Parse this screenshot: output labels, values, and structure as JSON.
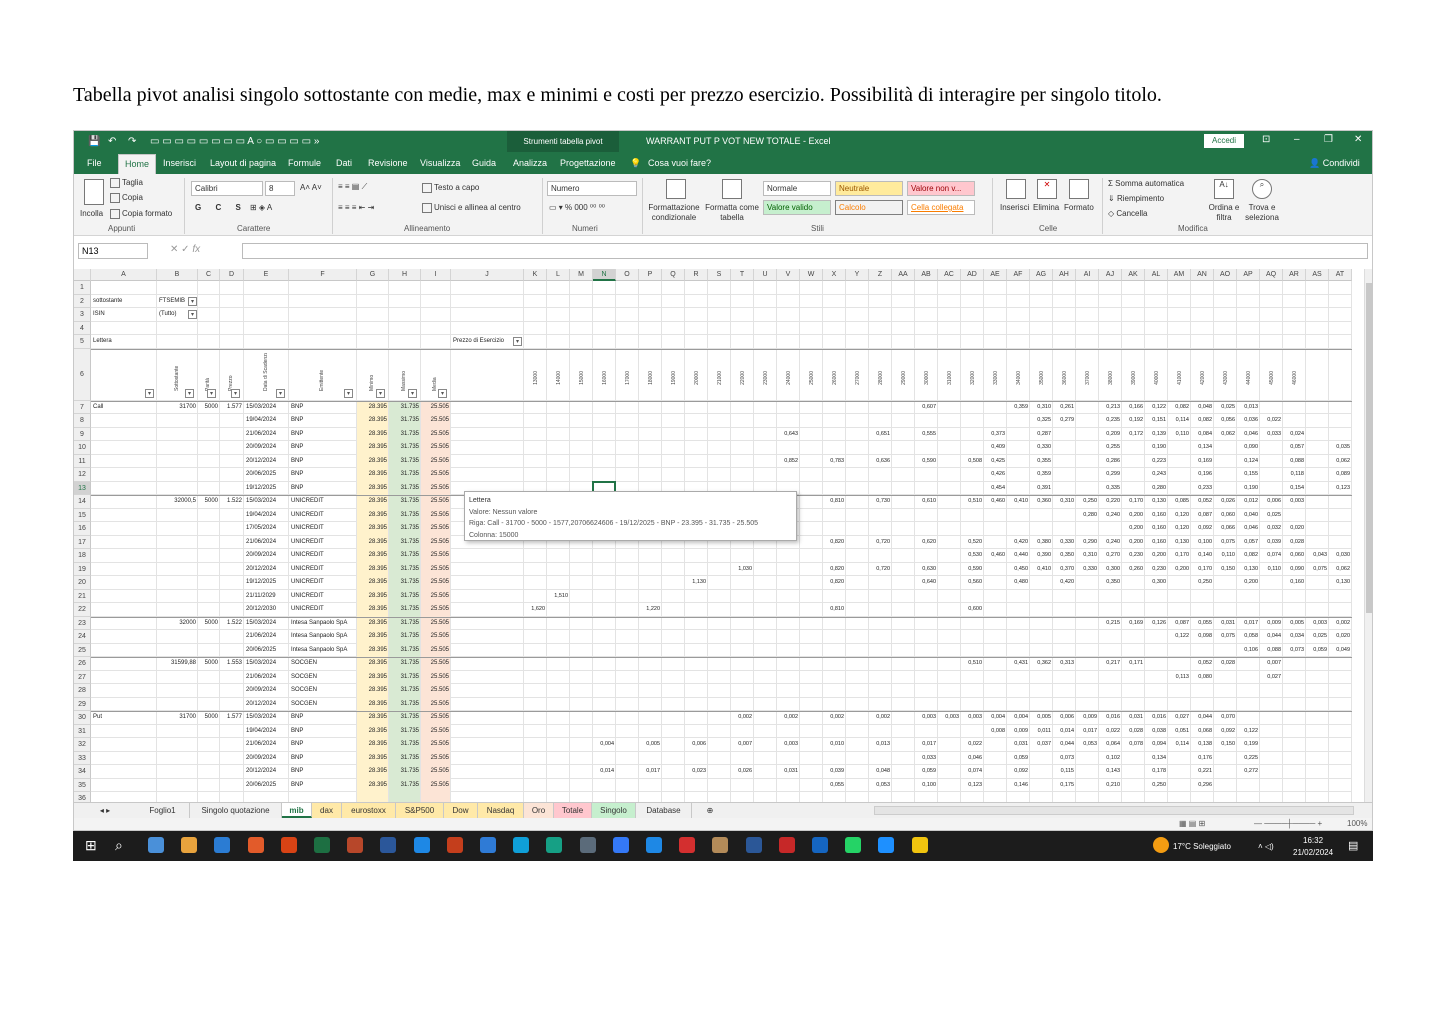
{
  "caption": "Tabella pivot analisi singolo sottostante con medie, max e minimi e costi per prezzo esercizio. Possibilità di interagire per singolo titolo.",
  "excel": {
    "context_tab": "Strumenti tabella pivot",
    "window_title": "WARRANT PUT P VOT NEW TOTALE - Excel",
    "signin": "Accedi",
    "menu": [
      "File",
      "Home",
      "Inserisci",
      "Layout di pagina",
      "Formule",
      "Dati",
      "Revisione",
      "Visualizza",
      "Guida",
      "Analizza",
      "Progettazione",
      "Cosa vuoi fare?"
    ],
    "share": "Condividi",
    "ribbon": {
      "paste": "Incolla",
      "cut": "Taglia",
      "copy": "Copia",
      "format_painter": "Copia formato",
      "font_name": "Calibri",
      "font_size": "8",
      "wrap_text": "Testo a capo",
      "merge": "Unisci e allinea al centro",
      "number_format": "Numero",
      "cond_format": "Formattazione condizionale",
      "format_table": "Formatta come tabella",
      "styles": [
        "Normale",
        "Neutrale",
        "Valore non v...",
        "Valore valido",
        "Calcolo",
        "Cella collegata"
      ],
      "insert": "Inserisci",
      "delete": "Elimina",
      "format": "Formato",
      "autosum": "Somma automatica",
      "fill": "Riempimento",
      "clear": "Cancella",
      "sort_filter": "Ordina e filtra",
      "find_select": "Trova e seleziona",
      "groups": [
        "Appunti",
        "Carattere",
        "Allineamento",
        "Numeri",
        "Stili",
        "Celle",
        "Modifica"
      ]
    },
    "name_box": "N13",
    "columns": [
      "A",
      "B",
      "C",
      "D",
      "E",
      "F",
      "G",
      "H",
      "I",
      "J",
      "K",
      "L",
      "M",
      "N",
      "O",
      "P",
      "Q",
      "R",
      "S",
      "T",
      "U",
      "V",
      "W",
      "X",
      "Y",
      "Z",
      "AA",
      "AB",
      "AC",
      "AD",
      "AE",
      "AF",
      "AG",
      "AH",
      "AI",
      "AJ",
      "AK",
      "AL",
      "AM",
      "AN",
      "AO",
      "AP",
      "AQ",
      "AR",
      "AS",
      "AT"
    ],
    "filters": {
      "row2_label": "sottostante",
      "row2_value": "FTSEMIB",
      "row3_label": "ISIN",
      "row3_value": "(Tutto)"
    },
    "row5": {
      "a": "Lettera",
      "j": "Prezzo di Esercizio"
    },
    "strikes": [
      "13000",
      "14000",
      "15000",
      "16000",
      "17000",
      "18000",
      "19000",
      "20000",
      "21000",
      "22000",
      "23000",
      "24000",
      "25000",
      "26000",
      "27000",
      "28000",
      "29000",
      "30000",
      "31000",
      "32000",
      "33000",
      "34000",
      "35000",
      "36000",
      "37000",
      "38000",
      "39000",
      "40000",
      "41000",
      "42000",
      "43000",
      "44000",
      "45000",
      "46000"
    ],
    "header_labels": {
      "b": "Sottostante",
      "c": "Parità",
      "d": "Prezzo",
      "e": "Data di Scadenza",
      "f": "Emittente",
      "g": "Minimo",
      "h": "Massimo",
      "i": "Media"
    },
    "rows": [
      {
        "n": 7,
        "a": "Call",
        "b": "31700",
        "c": "5000",
        "d": "1.577",
        "e": "15/03/2024",
        "f": "BNP",
        "g": "28.395",
        "h": "31.735",
        "i": "25.505",
        "v": {
          "AB": "0,607",
          "AF": "0,359",
          "AG": "0,310",
          "AH": "0,261",
          "AJ": "0,213",
          "AK": "0,166",
          "AL": "0,122",
          "AM": "0,082",
          "AN": "0,048",
          "AO": "0,025",
          "AP": "0,013"
        }
      },
      {
        "n": 8,
        "e": "19/04/2024",
        "f": "BNP",
        "g": "28.395",
        "h": "31.735",
        "i": "25.505",
        "v": {
          "AG": "0,325",
          "AH": "0,279",
          "AJ": "0,235",
          "AK": "0,192",
          "AL": "0,151",
          "AM": "0,114",
          "AN": "0,082",
          "AO": "0,056",
          "AP": "0,036",
          "AQ": "0,022"
        }
      },
      {
        "n": 9,
        "e": "21/06/2024",
        "f": "BNP",
        "g": "28.395",
        "h": "31.735",
        "i": "25.505",
        "v": {
          "V": "0,643",
          "Z": "0,651",
          "AB": "0,555",
          "AE": "0,373",
          "AG": "0,287",
          "AJ": "0,209",
          "AK": "0,172",
          "AL": "0,139",
          "AM": "0,110",
          "AN": "0,084",
          "AO": "0,062",
          "AP": "0,046",
          "AQ": "0,033",
          "AR": "0,024"
        }
      },
      {
        "n": 10,
        "e": "20/09/2024",
        "f": "BNP",
        "g": "28.395",
        "h": "31.735",
        "i": "25.505",
        "v": {
          "AE": "0,409",
          "AG": "0,330",
          "AJ": "0,255",
          "AL": "0,190",
          "AN": "0,134",
          "AP": "0,090",
          "AR": "0,057",
          "AT": "0,035"
        }
      },
      {
        "n": 11,
        "e": "20/12/2024",
        "f": "BNP",
        "g": "28.395",
        "h": "31.735",
        "i": "25.505",
        "v": {
          "V": "0,852",
          "X": "0,783",
          "Z": "0,636",
          "AB": "0,590",
          "AD": "0,508",
          "AE": "0,425",
          "AG": "0,355",
          "AJ": "0,286",
          "AL": "0,223",
          "AN": "0,169",
          "AP": "0,124",
          "AR": "0,088",
          "AT": "0,062"
        }
      },
      {
        "n": 12,
        "e": "20/06/2025",
        "f": "BNP",
        "g": "28.395",
        "h": "31.735",
        "i": "25.505",
        "v": {
          "AE": "0,426",
          "AG": "0,359",
          "AJ": "0,299",
          "AL": "0,243",
          "AN": "0,196",
          "AP": "0,155",
          "AR": "0,118",
          "AT": "0,089"
        }
      },
      {
        "n": 13,
        "e": "19/12/2025",
        "f": "BNP",
        "g": "28.395",
        "h": "31.735",
        "i": "25.505",
        "v": {
          "AE": "0,454",
          "AG": "0,391",
          "AJ": "0,335",
          "AL": "0,280",
          "AN": "0,233",
          "AP": "0,190",
          "AR": "0,154",
          "AT": "0,123"
        }
      },
      {
        "n": 14,
        "b": "32000,5",
        "c": "5000",
        "d": "1.522",
        "e": "15/03/2024",
        "f": "UNICREDIT",
        "g": "28.395",
        "h": "31.735",
        "i": "25.505",
        "v": {
          "X": "0,810",
          "Z": "0,730",
          "AB": "0,610",
          "AD": "0,510",
          "AE": "0,460",
          "AF": "0,410",
          "AG": "0,360",
          "AH": "0,310",
          "AI": "0,250",
          "AJ": "0,220",
          "AK": "0,170",
          "AL": "0,130",
          "AM": "0,085",
          "AN": "0,052",
          "AO": "0,026",
          "AP": "0,012",
          "AQ": "0,006",
          "AR": "0,003"
        }
      },
      {
        "n": 15,
        "e": "19/04/2024",
        "f": "UNICREDIT",
        "g": "28.395",
        "h": "31.735",
        "i": "25.505",
        "v": {
          "AI": "0,280",
          "AJ": "0,240",
          "AK": "0,200",
          "AL": "0,160",
          "AM": "0,120",
          "AN": "0,087",
          "AO": "0,060",
          "AP": "0,040",
          "AQ": "0,025"
        }
      },
      {
        "n": 16,
        "e": "17/05/2024",
        "f": "UNICREDIT",
        "g": "28.395",
        "h": "31.735",
        "i": "25.505",
        "v": {
          "AK": "0,200",
          "AL": "0,160",
          "AM": "0,120",
          "AN": "0,092",
          "AO": "0,066",
          "AP": "0,046",
          "AQ": "0,032",
          "AR": "0,020"
        }
      },
      {
        "n": 17,
        "e": "21/06/2024",
        "f": "UNICREDIT",
        "g": "28.395",
        "h": "31.735",
        "i": "25.505",
        "v": {
          "X": "0,820",
          "Z": "0,720",
          "AB": "0,620",
          "AD": "0,520",
          "AF": "0,420",
          "AG": "0,380",
          "AH": "0,330",
          "AI": "0,290",
          "AJ": "0,240",
          "AK": "0,200",
          "AL": "0,160",
          "AM": "0,130",
          "AN": "0,100",
          "AO": "0,075",
          "AP": "0,057",
          "AQ": "0,039",
          "AR": "0,028"
        }
      },
      {
        "n": 18,
        "e": "20/09/2024",
        "f": "UNICREDIT",
        "g": "28.395",
        "h": "31.735",
        "i": "25.505",
        "v": {
          "AD": "0,530",
          "AE": "0,460",
          "AF": "0,440",
          "AG": "0,390",
          "AH": "0,350",
          "AI": "0,310",
          "AJ": "0,270",
          "AK": "0,230",
          "AL": "0,200",
          "AM": "0,170",
          "AN": "0,140",
          "AO": "0,110",
          "AP": "0,082",
          "AQ": "0,074",
          "AR": "0,060",
          "AS": "0,043",
          "AT": "0,030"
        }
      },
      {
        "n": 19,
        "e": "20/12/2024",
        "f": "UNICREDIT",
        "g": "28.395",
        "h": "31.735",
        "i": "25.505",
        "v": {
          "T": "1,030",
          "X": "0,820",
          "Z": "0,720",
          "AB": "0,630",
          "AD": "0,590",
          "AF": "0,450",
          "AG": "0,410",
          "AH": "0,370",
          "AI": "0,330",
          "AJ": "0,300",
          "AK": "0,260",
          "AL": "0,230",
          "AM": "0,200",
          "AN": "0,170",
          "AO": "0,150",
          "AP": "0,130",
          "AQ": "0,110",
          "AR": "0,090",
          "AS": "0,075",
          "AT": "0,062"
        }
      },
      {
        "n": 20,
        "e": "19/12/2025",
        "f": "UNICREDIT",
        "g": "28.395",
        "h": "31.735",
        "i": "25.505",
        "v": {
          "R": "1,130",
          "X": "0,820",
          "AB": "0,640",
          "AD": "0,560",
          "AF": "0,480",
          "AH": "0,420",
          "AJ": "0,350",
          "AL": "0,300",
          "AN": "0,250",
          "AP": "0,200",
          "AR": "0,160",
          "AT": "0,130"
        }
      },
      {
        "n": 21,
        "e": "21/11/2029",
        "f": "UNICREDIT",
        "g": "28.395",
        "h": "31.735",
        "i": "25.505",
        "v": {
          "L": "1,510"
        }
      },
      {
        "n": 22,
        "e": "20/12/2030",
        "f": "UNICREDIT",
        "g": "28.395",
        "h": "31.735",
        "i": "25.505",
        "v": {
          "K": "1,620",
          "P": "1,220",
          "X": "0,810",
          "AD": "0,600"
        }
      },
      {
        "n": 23,
        "b": "32000",
        "c": "5000",
        "d": "1.522",
        "e": "15/03/2024",
        "f": "Intesa Sanpaolo SpA",
        "g": "28.395",
        "h": "31.735",
        "i": "25.505",
        "v": {
          "AJ": "0,215",
          "AK": "0,169",
          "AL": "0,126",
          "AM": "0,087",
          "AN": "0,055",
          "AO": "0,031",
          "AP": "0,017",
          "AQ": "0,009",
          "AR": "0,005",
          "AS": "0,003",
          "AT": "0,002"
        }
      },
      {
        "n": 24,
        "e": "21/06/2024",
        "f": "Intesa Sanpaolo SpA",
        "g": "28.395",
        "h": "31.735",
        "i": "25.505",
        "v": {
          "AM": "0,122",
          "AN": "0,098",
          "AO": "0,075",
          "AP": "0,058",
          "AQ": "0,044",
          "AR": "0,034",
          "AS": "0,025",
          "AT": "0,020"
        }
      },
      {
        "n": 25,
        "e": "20/06/2025",
        "f": "Intesa Sanpaolo SpA",
        "g": "28.395",
        "h": "31.735",
        "i": "25.505",
        "v": {
          "AP": "0,106",
          "AQ": "0,088",
          "AR": "0,073",
          "AS": "0,059",
          "AT": "0,049"
        }
      },
      {
        "n": 26,
        "b": "31599,88",
        "c": "5000",
        "d": "1.553",
        "e": "15/03/2024",
        "f": "SOCGEN",
        "g": "28.395",
        "h": "31.735",
        "i": "25.505",
        "v": {
          "AD": "0,510",
          "AF": "0,431",
          "AG": "0,362",
          "AH": "0,313",
          "AJ": "0,217",
          "AK": "0,171",
          "AN": "0,052",
          "AO": "0,028",
          "AQ": "0,007"
        }
      },
      {
        "n": 27,
        "e": "21/06/2024",
        "f": "SOCGEN",
        "g": "28.395",
        "h": "31.735",
        "i": "25.505",
        "v": {
          "AM": "0,113",
          "AN": "0,080",
          "AQ": "0,027"
        }
      },
      {
        "n": 28,
        "e": "20/09/2024",
        "f": "SOCGEN",
        "g": "28.395",
        "h": "31.735",
        "i": "25.505",
        "v": {}
      },
      {
        "n": 29,
        "e": "20/12/2024",
        "f": "SOCGEN",
        "g": "28.395",
        "h": "31.735",
        "i": "25.505",
        "v": {}
      },
      {
        "n": 30,
        "a": "Put",
        "b": "31700",
        "c": "5000",
        "d": "1.577",
        "e": "15/03/2024",
        "f": "BNP",
        "g": "28.395",
        "h": "31.735",
        "i": "25.505",
        "v": {
          "T": "0,002",
          "V": "0,002",
          "X": "0,002",
          "Z": "0,002",
          "AB": "0,003",
          "AC": "0,003",
          "AD": "0,003",
          "AE": "0,004",
          "AF": "0,004",
          "AG": "0,005",
          "AH": "0,006",
          "AI": "0,009",
          "AJ": "0,016",
          "AK": "0,031",
          "AL": "0,016",
          "AM": "0,027",
          "AN": "0,044",
          "AO": "0,070"
        }
      },
      {
        "n": 31,
        "e": "19/04/2024",
        "f": "BNP",
        "g": "28.395",
        "h": "31.735",
        "i": "25.505",
        "v": {
          "AE": "0,008",
          "AF": "0,009",
          "AG": "0,011",
          "AH": "0,014",
          "AI": "0,017",
          "AJ": "0,022",
          "AK": "0,028",
          "AL": "0,038",
          "AM": "0,051",
          "AN": "0,068",
          "AO": "0,092",
          "AP": "0,122"
        }
      },
      {
        "n": 32,
        "e": "21/06/2024",
        "f": "BNP",
        "g": "28.395",
        "h": "31.735",
        "i": "25.505",
        "v": {
          "N": "0,004",
          "P": "0,005",
          "R": "0,006",
          "T": "0,007",
          "V": "0,003",
          "X": "0,010",
          "Z": "0,013",
          "AB": "0,017",
          "AD": "0,022",
          "AF": "0,031",
          "AG": "0,037",
          "AH": "0,044",
          "AI": "0,053",
          "AJ": "0,064",
          "AK": "0,078",
          "AL": "0,094",
          "AM": "0,114",
          "AN": "0,138",
          "AO": "0,150",
          "AP": "0,199"
        }
      },
      {
        "n": 33,
        "e": "20/09/2024",
        "f": "BNP",
        "g": "28.395",
        "h": "31.735",
        "i": "25.505",
        "v": {
          "AB": "0,033",
          "AD": "0,046",
          "AF": "0,059",
          "AH": "0,073",
          "AJ": "0,102",
          "AL": "0,134",
          "AN": "0,176",
          "AP": "0,225"
        }
      },
      {
        "n": 34,
        "e": "20/12/2024",
        "f": "BNP",
        "g": "28.395",
        "h": "31.735",
        "i": "25.505",
        "v": {
          "N": "0,014",
          "P": "0,017",
          "R": "0,023",
          "T": "0,026",
          "V": "0,031",
          "X": "0,039",
          "Z": "0,048",
          "AB": "0,059",
          "AD": "0,074",
          "AF": "0,092",
          "AH": "0,115",
          "AJ": "0,143",
          "AL": "0,178",
          "AN": "0,221",
          "AP": "0,272"
        }
      },
      {
        "n": 35,
        "e": "20/06/2025",
        "f": "BNP",
        "g": "28.395",
        "h": "31.735",
        "i": "25.505",
        "v": {
          "X": "0,055",
          "Z": "0,053",
          "AB": "0,100",
          "AD": "0,123",
          "AF": "0,146",
          "AH": "0,175",
          "AJ": "0,210",
          "AL": "0,250",
          "AN": "0,296"
        }
      }
    ],
    "tooltip": [
      "Lettera",
      "Valore: Nessun valore",
      "Riga: Call - 31700 - 5000 - 1577,20706624606 - 19/12/2025 - BNP - 23.395 - 31.735 - 25.505",
      "Colonna: 15000"
    ],
    "sheets": [
      "Foglio1",
      "Singolo quotazione",
      "mib",
      "dax",
      "eurostoxx",
      "S&P500",
      "Dow",
      "Nasdaq",
      "Oro",
      "Totale",
      "Singolo",
      "Database"
    ],
    "active_sheet": "mib",
    "zoom": "100%"
  },
  "taskbar": {
    "weather": "17°C Soleggiato",
    "time": "16:32",
    "date": "21/02/2024"
  }
}
